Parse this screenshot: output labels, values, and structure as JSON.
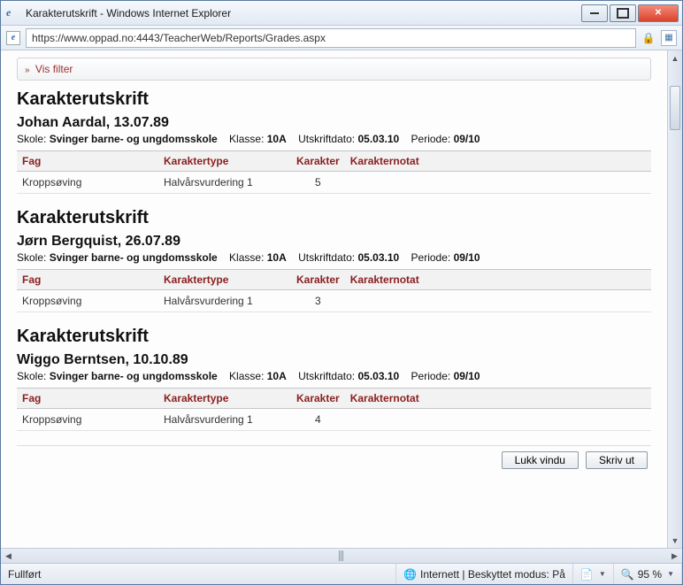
{
  "window": {
    "title": "Karakterutskrift - Windows Internet Explorer",
    "url": "https://www.oppad.no:4443/TeacherWeb/Reports/Grades.aspx"
  },
  "filter": {
    "label": "Vis filter"
  },
  "headers": {
    "fag": "Fag",
    "karaktertype": "Karaktertype",
    "karakter": "Karakter",
    "karakternotat": "Karakternotat"
  },
  "meta_labels": {
    "skole": "Skole:",
    "klasse": "Klasse:",
    "utskriftdato": "Utskriftdato:",
    "periode": "Periode:"
  },
  "section_title": "Karakterutskrift",
  "students": [
    {
      "name": "Johan Aardal, 13.07.89",
      "skole": "Svinger barne- og ungdomsskole",
      "klasse": "10A",
      "utskriftdato": "05.03.10",
      "periode": "09/10",
      "rows": [
        {
          "fag": "Kroppsøving",
          "type": "Halvårsvurdering 1",
          "kar": "5",
          "notat": ""
        }
      ]
    },
    {
      "name": "Jørn Bergquist, 26.07.89",
      "skole": "Svinger barne- og ungdomsskole",
      "klasse": "10A",
      "utskriftdato": "05.03.10",
      "periode": "09/10",
      "rows": [
        {
          "fag": "Kroppsøving",
          "type": "Halvårsvurdering 1",
          "kar": "3",
          "notat": ""
        }
      ]
    },
    {
      "name": "Wiggo Berntsen, 10.10.89",
      "skole": "Svinger barne- og ungdomsskole",
      "klasse": "10A",
      "utskriftdato": "05.03.10",
      "periode": "09/10",
      "rows": [
        {
          "fag": "Kroppsøving",
          "type": "Halvårsvurdering 1",
          "kar": "4",
          "notat": ""
        }
      ]
    }
  ],
  "buttons": {
    "close": "Lukk vindu",
    "print": "Skriv ut"
  },
  "status": {
    "left": "Fullført",
    "zone": "Internett | Beskyttet modus: På",
    "zoom": "95 %"
  }
}
